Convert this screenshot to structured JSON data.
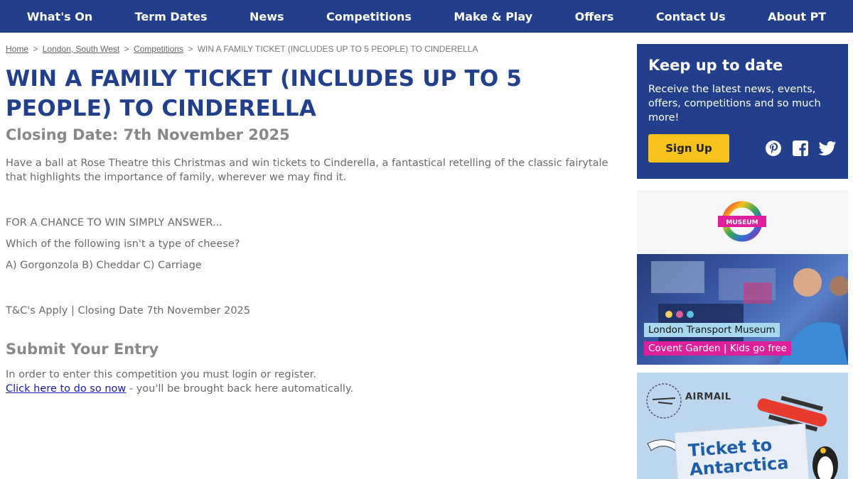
{
  "nav": {
    "items": [
      "What's On",
      "Term Dates",
      "News",
      "Competitions",
      "Make & Play",
      "Offers",
      "Contact Us",
      "About PT"
    ]
  },
  "breadcrumb": {
    "home": "Home",
    "region": "London, South West",
    "section": "Competitions",
    "current": "WIN A FAMILY TICKET (INCLUDES UP TO 5 PEOPLE) TO CINDERELLA",
    "separator": ">"
  },
  "article": {
    "title": "WIN A FAMILY TICKET (INCLUDES UP TO 5 PEOPLE) TO CINDERELLA",
    "closing_date": "Closing Date: 7th November 2025",
    "intro": "Have a ball at Rose Theatre  this Christmas and win tickets to Cinderella, a fantastical retelling of the classic fairytale that highlights the importance of family, wherever we may  find it.",
    "prompt": "FOR A CHANCE TO WIN SIMPLY ANSWER...",
    "question": "Which of the following isn't a type of cheese?",
    "options": "A) Gorgonzola B) Cheddar C) Carriage",
    "terms": "T&C's Apply | Closing Date 7th November 2025"
  },
  "submit": {
    "heading": "Submit Your Entry",
    "instruction": "In order to enter this competition you must login or register.",
    "link": "Click here to do so now",
    "suffix": " - you'll be brought back here automatically."
  },
  "signup": {
    "heading": "Keep up to date",
    "text": "Receive the latest news, events, offers, competitions and so much more!",
    "button": "Sign Up",
    "social": [
      "pinterest-icon",
      "facebook-icon",
      "twitter-icon"
    ]
  },
  "ad_museum": {
    "logo_text": "MUSEUM",
    "line1": "London Transport Museum",
    "line2": "Covent Garden | Kids go free"
  },
  "ad_antarctica": {
    "airmail": "AIRMAIL",
    "title_line1": "Ticket to",
    "title_line2": "Antarctica"
  },
  "colors": {
    "brand_blue": "#223f8c",
    "signup_yellow": "#f7c31b",
    "museum_pink": "#e0209a"
  }
}
